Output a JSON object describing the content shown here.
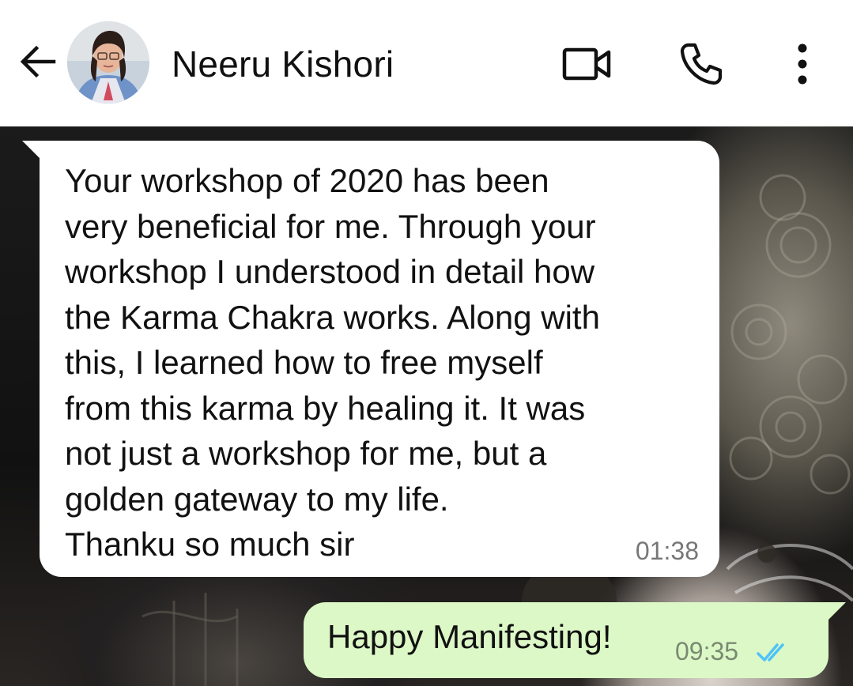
{
  "header": {
    "contact_name": "Neeru Kishori",
    "back_icon": "arrow-left-icon",
    "video_icon": "video-call-icon",
    "call_icon": "phone-icon",
    "menu_icon": "more-vert-icon"
  },
  "messages": [
    {
      "direction": "incoming",
      "text": "Your workshop of 2020 has been\nvery beneficial for me. Through your\nworkshop I understood in detail how\nthe Karma Chakra works. Along with\nthis, I learned how to free myself\nfrom this karma by healing it. It was\nnot just a workshop for me, but a\ngolden gateway to my life.\nThanku so much sir",
      "time": "01:38"
    },
    {
      "direction": "outgoing",
      "text": "Happy Manifesting!",
      "time": "09:35",
      "status_icon": "double-check-read-icon"
    }
  ],
  "colors": {
    "incoming_bubble": "#ffffff",
    "outgoing_bubble": "#dcf8c6",
    "read_ticks": "#4fc3f7"
  }
}
